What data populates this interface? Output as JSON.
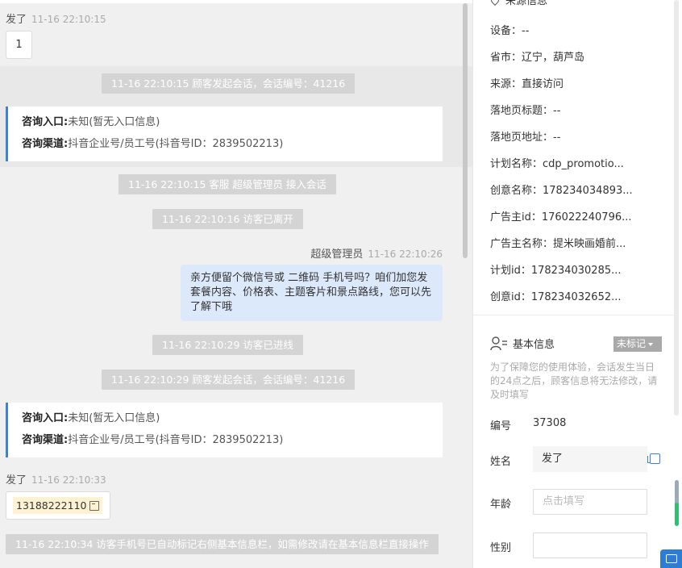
{
  "chat": {
    "msg1": {
      "sender": "发了",
      "time": "11-16 22:10:15",
      "content": "1"
    },
    "sys1": "11-16 22:10:15 顾客发起会话，会话编号：41216",
    "card1": {
      "entry_label": "咨询入口:",
      "entry_value": "未知(暂无入口信息)",
      "channel_label": "咨询渠道:",
      "channel_value": "抖音企业号/员工号(抖音号ID：2839502213)"
    },
    "sys2": "11-16 22:10:15 客服 超级管理员 接入会话",
    "sys3": "11-16 22:10:16 访客已离开",
    "msg2": {
      "sender": "超级管理员",
      "time": "11-16 22:10:26",
      "line1": "亲方便留个微信号或 二维码 手机号吗？咱们加您发",
      "line2": "套餐内容、价格表、主题客片和景点路线，您可以先",
      "line3": "了解下哦"
    },
    "sys4": "11-16 22:10:29 访客已进线",
    "sys5": "11-16 22:10:29 顾客发起会话，会话编号：41216",
    "card2": {
      "entry_label": "咨询入口:",
      "entry_value": "未知(暂无入口信息)",
      "channel_label": "咨询渠道:",
      "channel_value": "抖音企业号/员工号(抖音号ID：2839502213)"
    },
    "msg3": {
      "sender": "发了",
      "time": "11-16 22:10:33",
      "phone": "13188222110"
    },
    "sys6": "11-16 22:10:34 访客手机号已自动标记右侧基本信息栏，如需修改请在基本信息栏直接操作"
  },
  "side": {
    "source_header": "来源信息",
    "source_rows": [
      "设备：--",
      "省市：辽宁，葫芦岛",
      "来源：直接访问",
      "落地页标题：--",
      "落地页地址：--",
      "计划名称：cdp_promotio...",
      "创意名称：178234034893...",
      "广告主id：176022240796...",
      "广告主名称：提米映画婚前...",
      "计划id：178234030285...",
      "创意id：178234032652..."
    ],
    "basic_title": "基本信息",
    "tag_label": "未标记",
    "hint": "为了保障您的使用体验，会话发生当日的24点之后，顾客信息将无法修改，请及时填写",
    "id_label": "编号",
    "id_value": "37308",
    "name_label": "姓名",
    "name_value": "发了",
    "age_label": "年龄",
    "age_placeholder": "点击填写",
    "gender_label": "性别",
    "gender_placeholder": ""
  }
}
